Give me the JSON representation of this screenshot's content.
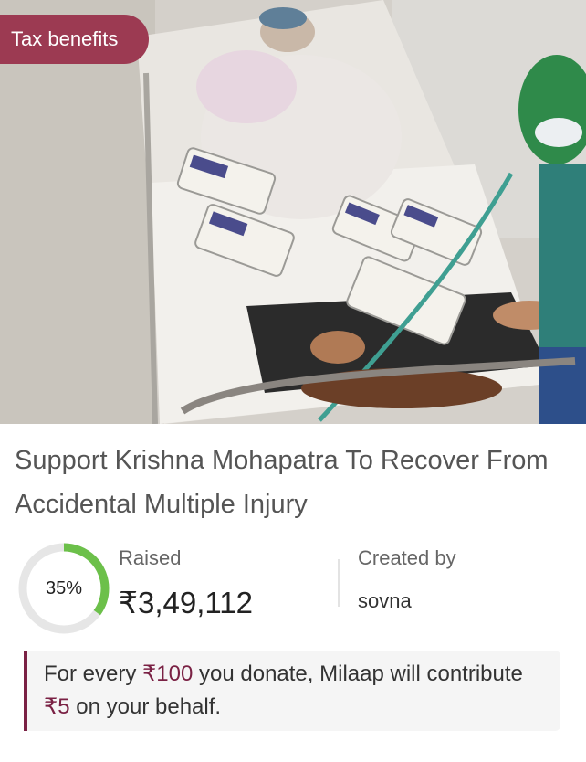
{
  "badge": {
    "label": "Tax benefits"
  },
  "campaign": {
    "title": "Support Krishna Mohapatra To Recover From Accidental Multiple Injury",
    "progress_percent": 35,
    "progress_label": "35%",
    "raised_label": "Raised",
    "raised_amount": "₹3,49,112",
    "created_by_label": "Created by",
    "creator": "sovna"
  },
  "note": {
    "part1": "For every ",
    "amount1": "₹100",
    "part2": " you donate, Milaap will contribute ",
    "amount2": "₹5",
    "part3": " on your behalf."
  },
  "colors": {
    "badge": "#9c3a52",
    "progress": "#6cc04a",
    "track": "#e6e6e6",
    "accent": "#7a2144"
  }
}
